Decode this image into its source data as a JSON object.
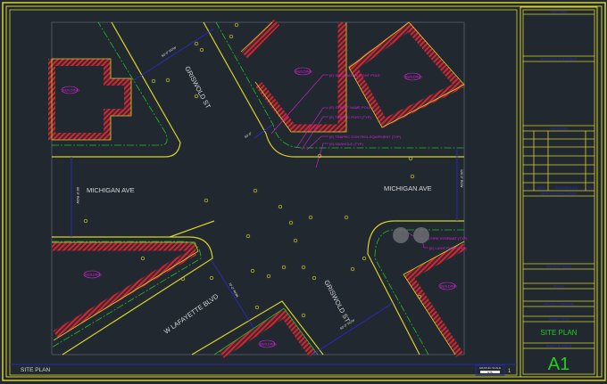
{
  "drawing": {
    "streets": {
      "michigan_west": "MICHIGAN AVE",
      "michigan_east": "MICHIGAN AVE",
      "griswold_north": "GRISWOLD ST",
      "griswold_south": "GRISWOLD ST",
      "lafayette": "W LAFAYETTE BLVD"
    },
    "building_label": "BUILDING",
    "callouts": [
      "(E) DECORATIVE LIGHT POLE",
      "(E) STREET NAME POLE",
      "(E) TRAFFIC POST (TYP)",
      "(E) TRAFFIC CONTROL EQUIPMENT (TYP)",
      "(E) MANHOLE (TYP)",
      "(E) FIRE HYDRANT (TYP)",
      "(E) LIGHT POST (TYP)"
    ],
    "dimensions": [
      "60'-0\" ROW",
      "60'-0\"",
      "80'-0\" ROW",
      "70'-0\" ROW",
      "120'-0\" ROW",
      "60'-0\" ROW"
    ]
  },
  "footer": {
    "view_title": "SITE PLAN",
    "scale_label": "GRAPHIC SCALE",
    "scale_value": "NTS",
    "view_number": "1"
  },
  "title_block": {
    "key_plan": "KEY PLAN",
    "architect": "ARCHITECT/ENGINEER",
    "revisions": "REVISIONS",
    "rev_headers": [
      "#",
      "DATE",
      "DESCRIPTION",
      "BY"
    ],
    "stamp": "PROFESSIONAL STAMP",
    "project_name": "PROJECT NAME",
    "scale": "SCALE",
    "project_number": "PROJECT NUMBER",
    "sheet_title_label": "SHEET TITLE",
    "sheet_title": "SITE PLAN",
    "sheet_number_label": "SHEET NUMBER",
    "sheet_number": "A1"
  },
  "colors": {
    "background": "#212830",
    "border": "#d6d22a",
    "hatch": "#e0202a",
    "centerline": "#20c020",
    "dimension": "#2a2ad0",
    "annotation": "#e020e0",
    "sheet_text": "#20d020"
  }
}
